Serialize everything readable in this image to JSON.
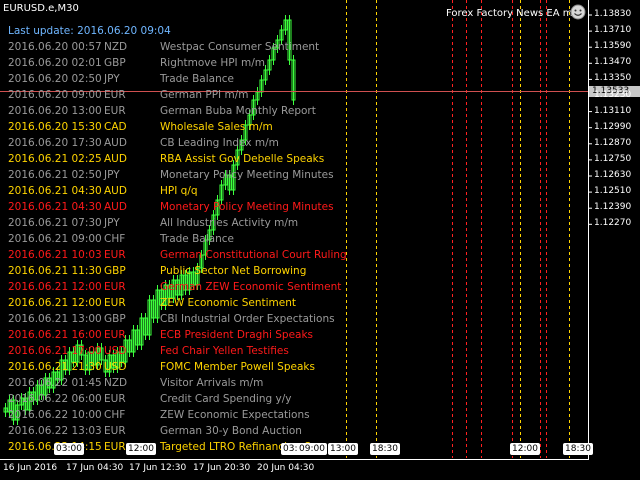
{
  "window": {
    "symbol": "EURUSD.e,M30"
  },
  "ea": {
    "title": "Forex Factory News EA mt5",
    "icon": "smiley-icon"
  },
  "last_update": "Last update: 2016.06.20 09:04",
  "colors": {
    "gray": "#9a9a9a",
    "yellow": "#ffd400",
    "red": "#ff1a1a",
    "candle": "#3dff3d",
    "bid_line": "#d05050",
    "event_line": "#ff2020",
    "session_line": "#ffd400"
  },
  "news": [
    {
      "date": "2016.06.20 00:57",
      "currency": "NZD",
      "title": "Westpac Consumer Sentiment",
      "impact": "gray"
    },
    {
      "date": "2016.06.20 02:01",
      "currency": "GBP",
      "title": "Rightmove HPI m/m",
      "impact": "gray"
    },
    {
      "date": "2016.06.20 02:50",
      "currency": "JPY",
      "title": "Trade Balance",
      "impact": "gray"
    },
    {
      "date": "2016.06.20 09:00",
      "currency": "EUR",
      "title": "German PPI m/m",
      "impact": "gray"
    },
    {
      "date": "2016.06.20 13:00",
      "currency": "EUR",
      "title": "German Buba Monthly Report",
      "impact": "gray"
    },
    {
      "date": "2016.06.20 15:30",
      "currency": "CAD",
      "title": "Wholesale Sales m/m",
      "impact": "yellow"
    },
    {
      "date": "2016.06.20 17:30",
      "currency": "AUD",
      "title": "CB Leading Index m/m",
      "impact": "gray"
    },
    {
      "date": "2016.06.21 02:25",
      "currency": "AUD",
      "title": "RBA Assist Gov Debelle Speaks",
      "impact": "yellow"
    },
    {
      "date": "2016.06.21 02:50",
      "currency": "JPY",
      "title": "Monetary Policy Meeting Minutes",
      "impact": "gray"
    },
    {
      "date": "2016.06.21 04:30",
      "currency": "AUD",
      "title": "HPI q/q",
      "impact": "yellow"
    },
    {
      "date": "2016.06.21 04:30",
      "currency": "AUD",
      "title": "Monetary Policy Meeting Minutes",
      "impact": "red"
    },
    {
      "date": "2016.06.21 07:30",
      "currency": "JPY",
      "title": "All Industries Activity m/m",
      "impact": "gray"
    },
    {
      "date": "2016.06.21 09:00",
      "currency": "CHF",
      "title": "Trade Balance",
      "impact": "gray"
    },
    {
      "date": "2016.06.21 10:03",
      "currency": "EUR",
      "title": "German Constitutional Court Ruling",
      "impact": "red"
    },
    {
      "date": "2016.06.21 11:30",
      "currency": "GBP",
      "title": "Public Sector Net Borrowing",
      "impact": "yellow"
    },
    {
      "date": "2016.06.21 12:00",
      "currency": "EUR",
      "title": "German ZEW Economic Sentiment",
      "impact": "red"
    },
    {
      "date": "2016.06.21 12:00",
      "currency": "EUR",
      "title": "ZEW Economic Sentiment",
      "impact": "yellow"
    },
    {
      "date": "2016.06.21 13:00",
      "currency": "GBP",
      "title": "CBI Industrial Order Expectations",
      "impact": "gray"
    },
    {
      "date": "2016.06.21 16:00",
      "currency": "EUR",
      "title": "ECB President Draghi Speaks",
      "impact": "red"
    },
    {
      "date": "2016.06.21 17:00",
      "currency": "USD",
      "title": "Fed Chair Yellen Testifies",
      "impact": "red"
    },
    {
      "date": "2016.06.21 21:30",
      "currency": "USD",
      "title": "FOMC Member Powell Speaks",
      "impact": "yellow"
    },
    {
      "date": "2016.06.22 01:45",
      "currency": "NZD",
      "title": "Visitor Arrivals m/m",
      "impact": "gray"
    },
    {
      "date": "2016.06.22 06:00",
      "currency": "EUR",
      "title": "Credit Card Spending y/y",
      "impact": "gray"
    },
    {
      "date": "2016.06.22 10:00",
      "currency": "CHF",
      "title": "ZEW Economic Expectations",
      "impact": "gray"
    },
    {
      "date": "2016.06.22 13:03",
      "currency": "EUR",
      "title": "German 30-y Bond Auction",
      "impact": "gray"
    },
    {
      "date": "2016.06.22 14:15",
      "currency": "EUR",
      "title": "Targeted LTRO Refinancing Op",
      "impact": "yellow"
    }
  ],
  "price_axis": {
    "labels": [
      "1.13830",
      "1.13710",
      "1.13590",
      "1.13470",
      "1.13350",
      "1.13230",
      "1.13110",
      "1.12990",
      "1.12870",
      "1.12750",
      "1.12630",
      "1.12510",
      "1.12390",
      "1.12270"
    ],
    "current_price": "1.13533"
  },
  "time_axis": {
    "labels": [
      "16 Jun 2016",
      "17 Jun 04:30",
      "17 Jun 12:30",
      "17 Jun 20:30",
      "20 Jun 04:30"
    ]
  },
  "session_boxes": [
    "03:00",
    "12:00",
    "03:00",
    "09:00",
    "13:00",
    "18:30",
    "12:00",
    "18:30"
  ]
}
